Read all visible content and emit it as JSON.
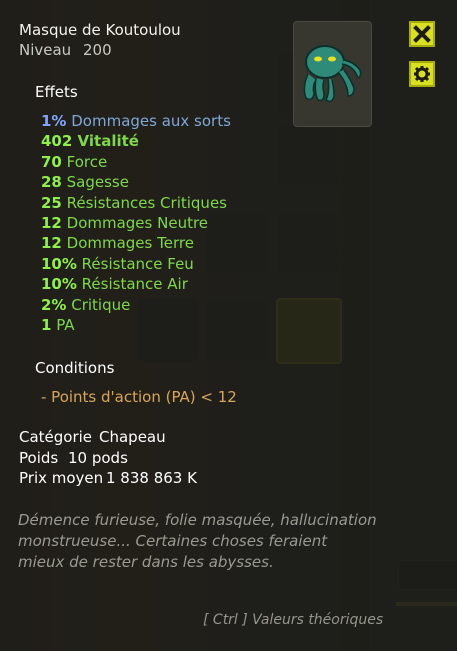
{
  "item": {
    "name": "Masque de Koutoulou",
    "level_label": "Niveau",
    "level": "200"
  },
  "effects": {
    "heading": "Effets",
    "list": [
      {
        "value": "1%",
        "label": "Dommages aux sorts",
        "color": "blue"
      },
      {
        "value": "402",
        "label": "Vitalité",
        "color": "green",
        "bold_label": true
      },
      {
        "value": "70",
        "label": "Force",
        "color": "green"
      },
      {
        "value": "28",
        "label": "Sagesse",
        "color": "green"
      },
      {
        "value": "25",
        "label": "Résistances Critiques",
        "color": "green"
      },
      {
        "value": "12",
        "label": "Dommages Neutre",
        "color": "green"
      },
      {
        "value": "12",
        "label": "Dommages Terre",
        "color": "green"
      },
      {
        "value": "10%",
        "label": "Résistance Feu",
        "color": "green"
      },
      {
        "value": "10%",
        "label": "Résistance Air",
        "color": "green"
      },
      {
        "value": "2%",
        "label": "Critique",
        "color": "green"
      },
      {
        "value": "1",
        "label": "PA",
        "color": "green"
      }
    ]
  },
  "conditions": {
    "heading": "Conditions",
    "items": [
      "- Points d'action (PA) < 12"
    ]
  },
  "details": {
    "category_label": "Catégorie",
    "category": "Chapeau",
    "weight_label": "Poids",
    "weight": "10 pods",
    "price_label": "Prix moyen",
    "price": "1 838 863 K"
  },
  "description": "Démence furieuse, folie masquée, hallucination monstrueuse...  Certaines choses feraient mieux de rester dans les abysses.",
  "hint": "[ Ctrl ] Valeurs théoriques",
  "icons": {
    "close": "close-icon",
    "settings": "gear-icon",
    "item": "octopus-mask-icon"
  },
  "colors": {
    "accent": "#d8e020",
    "effect_green": "#7ed84a",
    "effect_blue": "#7fa7d6",
    "condition": "#d9a659"
  }
}
